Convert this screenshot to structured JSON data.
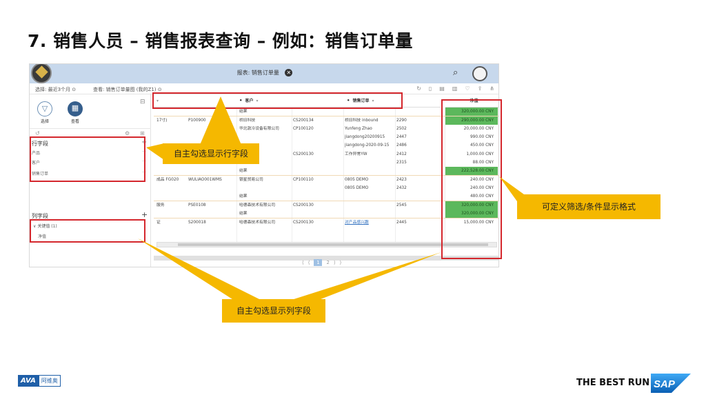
{
  "slide": {
    "title": "7. 销售人员 – 销售报表查询 – 例如：销售订单量"
  },
  "shell": {
    "title": "报表: 销售订单量",
    "close_glyph": "✕",
    "search_glyph": "⌕"
  },
  "toolbar": {
    "select_label": "选择: 最近3个月 ⊙",
    "view_label": "查看: 销售订单量图 (我的Z1) ⊙",
    "icons": [
      "↻",
      "▯",
      "▤",
      "▥",
      "♡",
      "⇪",
      "⋔"
    ]
  },
  "leftpanel": {
    "filter_label": "选择",
    "view_label": "查看",
    "row_section_title": "行字段",
    "row_items": [
      "产品",
      "客户",
      "销售订单"
    ],
    "col_section_title": "列字段",
    "col_group": "关键值 (1)",
    "col_item": "净值"
  },
  "grid": {
    "headers": {
      "customer": "客户",
      "sales_order": "销售订单",
      "net_value": "净值"
    },
    "rows": [
      {
        "c0": "",
        "c1": "",
        "c2": "结果",
        "c3": "",
        "c4": "",
        "c5": "",
        "c6": "320,000.00 CNY",
        "green": true,
        "sep": false
      },
      {
        "c0": "17寸)",
        "c1": "P100900",
        "c2": "桥旧科技",
        "c3": "CS200134",
        "c4": "桥旧科技 inbound",
        "c5": "2290",
        "c6": "290,000.00 CNY",
        "green": true,
        "sep": true
      },
      {
        "c0": "",
        "c1": "",
        "c2": "华北敦冷设备有限公司",
        "c3": "CP100120",
        "c4": "Yunfeng Zhao",
        "c5": "2502",
        "c6": "20,000.00 CNY",
        "green": false,
        "sep": false
      },
      {
        "c0": "",
        "c1": "",
        "c2": "",
        "c3": "",
        "c4": "jiangdong20200915",
        "c5": "2447",
        "c6": "990.00 CNY",
        "green": false,
        "sep": false
      },
      {
        "c0": "",
        "c1": "",
        "c2": "",
        "c3": "",
        "c4": "jiangdong-2020-09-15",
        "c5": "2486",
        "c6": "450.00 CNY",
        "green": false,
        "sep": false
      },
      {
        "c0": "",
        "c1": "",
        "c2": "术有限公司",
        "c3": "CS200130",
        "c4": "工作异常YW",
        "c5": "2412",
        "c6": "1,000.00 CNY",
        "green": false,
        "sep": false
      },
      {
        "c0": "",
        "c1": "",
        "c2": "",
        "c3": "",
        "c4": "",
        "c5": "2315",
        "c6": "88.00 CNY",
        "green": false,
        "sep": false
      },
      {
        "c0": "",
        "c1": "",
        "c2": "结果",
        "c3": "",
        "c4": "",
        "c5": "",
        "c6": "222,528.00 CNY",
        "green": true,
        "sep": false
      },
      {
        "c0": "成品 FG020",
        "c1": "WULIAO001WMS",
        "c2": "银星贸易公司",
        "c3": "CP100110",
        "c4": "0805 DEMO",
        "c5": "2423",
        "c6": "240.00 CNY",
        "green": false,
        "sep": true
      },
      {
        "c0": "",
        "c1": "",
        "c2": "",
        "c3": "",
        "c4": "0805 DEMO",
        "c5": "2432",
        "c6": "240.00 CNY",
        "green": false,
        "sep": false
      },
      {
        "c0": "",
        "c1": "",
        "c2": "结果",
        "c3": "",
        "c4": "",
        "c5": "",
        "c6": "480.00 CNY",
        "green": false,
        "sep": false
      },
      {
        "c0": "服务",
        "c1": "PSE0108",
        "c2": "哈德森技术有限公司",
        "c3": "CS200130",
        "c4": "",
        "c5": "2545",
        "c6": "320,000.00 CNY",
        "green": true,
        "sep": true
      },
      {
        "c0": "",
        "c1": "",
        "c2": "结果",
        "c3": "",
        "c4": "",
        "c5": "",
        "c6": "320,000.00 CNY",
        "green": true,
        "sep": false
      },
      {
        "c0": "证",
        "c1": "S200018",
        "c2": "哈德森技术有限公司",
        "c3": "CS200130",
        "c4": "对产品感兴趣",
        "c5": "2445",
        "c6": "15,000.00 CNY",
        "green": false,
        "sep": true,
        "link": true
      }
    ],
    "pager": [
      "⟨",
      "⟨",
      "1",
      "2",
      "⟩",
      "⟩"
    ]
  },
  "callouts": {
    "row_fields": "自主勾选显示行字段",
    "conditional_format": "可定义筛选/条件显示格式",
    "col_fields": "自主勾选显示列字段"
  },
  "footer": {
    "ava_logo": "AVA",
    "ava_text": "阿维奥",
    "tagline": "THE BEST RUN",
    "sap": "SAP"
  },
  "colors": {
    "highlight_red": "#d4262c",
    "callout_yellow": "#f5b800",
    "green_cell": "#5cb85c",
    "shell_blue": "#c7d8ec"
  }
}
